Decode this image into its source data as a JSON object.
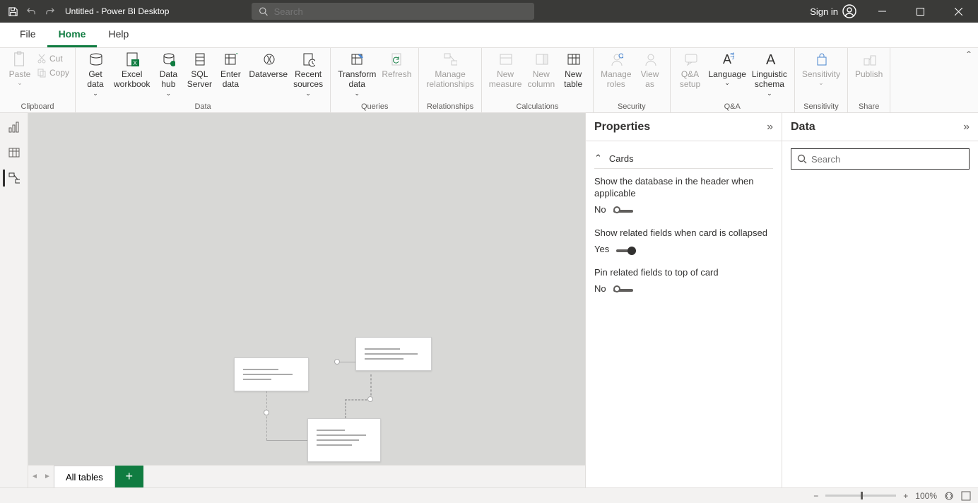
{
  "titlebar": {
    "title": "Untitled - Power BI Desktop",
    "search_placeholder": "Search",
    "signin": "Sign in"
  },
  "ribbon_tabs": {
    "file": "File",
    "home": "Home",
    "help": "Help"
  },
  "ribbon": {
    "clipboard": {
      "label": "Clipboard",
      "paste": "Paste",
      "cut": "Cut",
      "copy": "Copy"
    },
    "data": {
      "label": "Data",
      "get_data": "Get\ndata",
      "excel": "Excel\nworkbook",
      "hub": "Data\nhub",
      "sql": "SQL\nServer",
      "enter": "Enter\ndata",
      "dataverse": "Dataverse",
      "recent": "Recent\nsources"
    },
    "queries": {
      "label": "Queries",
      "transform": "Transform\ndata",
      "refresh": "Refresh"
    },
    "relationships": {
      "label": "Relationships",
      "manage": "Manage\nrelationships"
    },
    "calculations": {
      "label": "Calculations",
      "measure": "New\nmeasure",
      "column": "New\ncolumn",
      "table": "New\ntable"
    },
    "security": {
      "label": "Security",
      "roles": "Manage\nroles",
      "view": "View\nas"
    },
    "qa": {
      "label": "Q&A",
      "setup": "Q&A\nsetup",
      "language": "Language",
      "schema": "Linguistic\nschema"
    },
    "sensitivity": {
      "label": "Sensitivity",
      "item": "Sensitivity"
    },
    "share": {
      "label": "Share",
      "publish": "Publish"
    }
  },
  "tabs": {
    "all": "All tables"
  },
  "properties": {
    "title": "Properties",
    "section": "Cards",
    "p1": {
      "desc": "Show the database in the header when applicable",
      "val": "No"
    },
    "p2": {
      "desc": "Show related fields when card is collapsed",
      "val": "Yes"
    },
    "p3": {
      "desc": "Pin related fields to top of card",
      "val": "No"
    }
  },
  "data_pane": {
    "title": "Data",
    "search_placeholder": "Search"
  },
  "status": {
    "zoom": "100%"
  }
}
